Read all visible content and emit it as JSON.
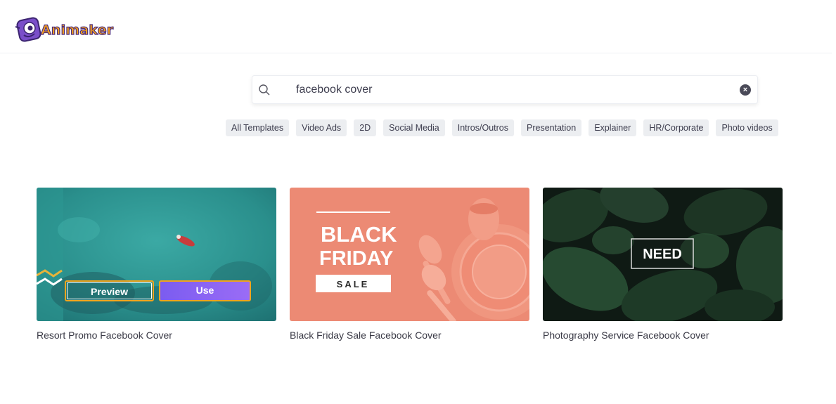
{
  "header": {
    "brand": "Animaker"
  },
  "search": {
    "value": "facebook cover",
    "placeholder": ""
  },
  "categories": [
    "All Templates",
    "Video Ads",
    "2D",
    "Social Media",
    "Intros/Outros",
    "Presentation",
    "Explainer",
    "HR/Corporate",
    "Photo videos"
  ],
  "cards": [
    {
      "title": "Resort Promo Facebook Cover",
      "preview_label": "Preview",
      "use_label": "Use"
    },
    {
      "title": "Black Friday Sale Facebook Cover",
      "headline_1": "BLACK",
      "headline_2": "FRIDAY",
      "tag": "SALE"
    },
    {
      "title": "Photography Service Facebook Cover",
      "headline": "NEED"
    }
  ],
  "colors": {
    "accent": "#f0a41d",
    "use_button": "#8a64f3",
    "chip_bg": "#eceef1"
  }
}
